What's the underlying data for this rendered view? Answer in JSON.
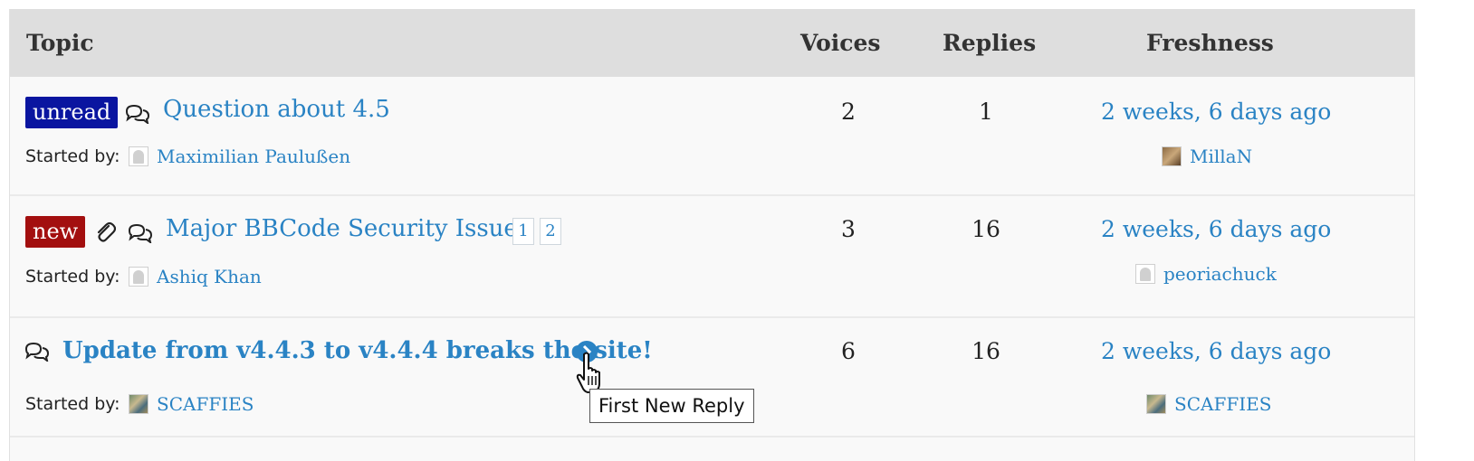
{
  "header": {
    "topic": "Topic",
    "voices": "Voices",
    "replies": "Replies",
    "freshness": "Freshness"
  },
  "topics": [
    {
      "badge": "unread",
      "icons": [
        "discussion-icon"
      ],
      "title": "Question about 4.5",
      "started_label": "Started by:",
      "author": "Maximilian Paulußen",
      "voices": "2",
      "replies": "1",
      "freshness": "2 weeks, 6 days ago",
      "last_user": "MillaN"
    },
    {
      "badge": "new",
      "icons": [
        "paperclip-icon",
        "discussion-icon"
      ],
      "title": "Major BBCode Security Issue",
      "pages": [
        "1",
        "2"
      ],
      "started_label": "Started by:",
      "author": "Ashiq Khan",
      "voices": "3",
      "replies": "16",
      "freshness": "2 weeks, 6 days ago",
      "last_user": "peoriachuck"
    },
    {
      "icons": [
        "discussion-icon",
        "first-new-reply-icon"
      ],
      "title": "Update from v4.4.3 to v4.4.4 breaks the site!",
      "started_label": "Started by:",
      "author": "SCAFFIES",
      "voices": "6",
      "replies": "16",
      "freshness": "2 weeks, 6 days ago",
      "last_user": "SCAFFIES"
    }
  ],
  "tooltip": "First New Reply",
  "colors": {
    "link": "#2a83c4",
    "unread_badge": "#0a15a0",
    "new_badge": "#a30f0f",
    "header_bg": "#dedede"
  }
}
